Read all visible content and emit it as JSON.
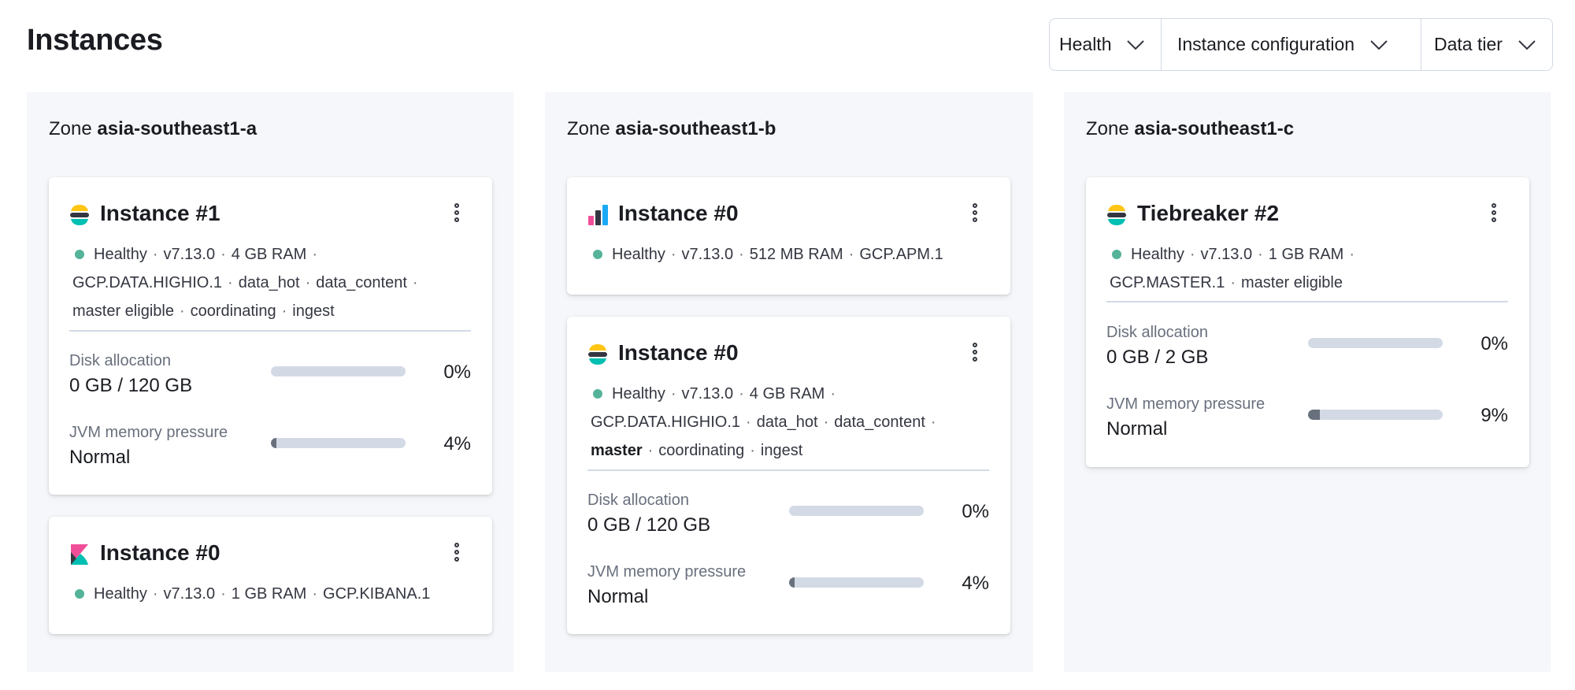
{
  "page_title": "Instances",
  "filters": [
    {
      "label": "Health"
    },
    {
      "label": "Instance configuration"
    },
    {
      "label": "Data tier"
    }
  ],
  "colors": {
    "healthy": "#54b399",
    "zone_bg": "#f5f7fa",
    "bar_track": "#d3dae6",
    "bar_fill": "#69707d"
  },
  "zones": [
    {
      "label": "Zone",
      "name": "asia-southeast1-a",
      "cards": [
        {
          "title": "Instance #1",
          "logo": "elasticsearch-logo",
          "lines": [
            [
              "Healthy",
              "v7.13.0",
              "4 GB RAM"
            ],
            [
              "GCP.DATA.HIGHIO.1",
              "data_hot",
              "data_content"
            ],
            [
              "master eligible",
              "coordinating",
              "ingest"
            ]
          ],
          "disk": {
            "label": "Disk allocation",
            "value": "0 GB / 120 GB",
            "percent": "0%",
            "fraction": 0
          },
          "jvm": {
            "label": "JVM memory pressure",
            "value": "Normal",
            "percent": "4%",
            "fraction": 0.04
          }
        },
        {
          "title": "Instance #0",
          "logo": "kibana-logo",
          "lines": [
            [
              "Healthy",
              "v7.13.0",
              "1 GB RAM",
              "GCP.KIBANA.1"
            ]
          ]
        }
      ]
    },
    {
      "label": "Zone",
      "name": "asia-southeast1-b",
      "cards": [
        {
          "title": "Instance #0",
          "logo": "apm-logo",
          "lines": [
            [
              "Healthy",
              "v7.13.0",
              "512 MB RAM",
              "GCP.APM.1"
            ]
          ]
        },
        {
          "title": "Instance #0",
          "logo": "elasticsearch-logo",
          "lines": [
            [
              "Healthy",
              "v7.13.0",
              "4 GB RAM"
            ],
            [
              "GCP.DATA.HIGHIO.1",
              "data_hot",
              "data_content"
            ],
            [
              "master",
              "coordinating",
              "ingest"
            ]
          ],
          "disk": {
            "label": "Disk allocation",
            "value": "0 GB / 120 GB",
            "percent": "0%",
            "fraction": 0
          },
          "jvm": {
            "label": "JVM memory pressure",
            "value": "Normal",
            "percent": "4%",
            "fraction": 0.04
          }
        }
      ]
    },
    {
      "label": "Zone",
      "name": "asia-southeast1-c",
      "cards": [
        {
          "title": "Tiebreaker #2",
          "logo": "elasticsearch-logo",
          "lines": [
            [
              "Healthy",
              "v7.13.0",
              "1 GB RAM"
            ],
            [
              "GCP.MASTER.1",
              "master eligible"
            ]
          ],
          "disk": {
            "label": "Disk allocation",
            "value": "0 GB / 2 GB",
            "percent": "0%",
            "fraction": 0
          },
          "jvm": {
            "label": "JVM memory pressure",
            "value": "Normal",
            "percent": "9%",
            "fraction": 0.09
          }
        }
      ]
    }
  ]
}
